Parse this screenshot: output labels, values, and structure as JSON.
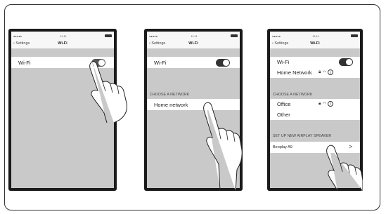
{
  "statusbar": {
    "carrier": "●●●●● ",
    "time": "11:11"
  },
  "panels": [
    {
      "nav": {
        "back": "Settings",
        "title": "Wi-Fi"
      },
      "wifi_label": "Wi-Fi"
    },
    {
      "nav": {
        "back": "Settings",
        "title": "Wi-Fi"
      },
      "wifi_label": "Wi-Fi",
      "section_choose": "CHOOSE A NETWORK",
      "network": "Home network"
    },
    {
      "nav": {
        "back": "Settings",
        "title": "Wi-Fi"
      },
      "wifi_label": "Wi-Fi",
      "connected_network": "Home Network",
      "section_choose": "CHOOSE A NETWORK",
      "networks": [
        "Office",
        "Other"
      ],
      "section_airplay": "SET UP NEW AIRPLAY SPEAKER",
      "speaker": "Beoplay A9",
      "speaker_chevron": ">"
    }
  ]
}
